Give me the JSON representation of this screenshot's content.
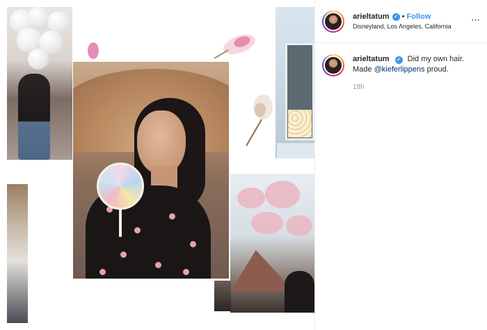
{
  "post": {
    "username": "arieltatum",
    "verified_icon": "verified-badge-icon",
    "separator": "•",
    "follow_label": "Follow",
    "location": "Disneyland, Los Angeles, California",
    "more_icon": "more-options-icon"
  },
  "caption": {
    "username": "arieltatum",
    "text_before": "Did my own hair. Made",
    "mention": "@kieferlippens",
    "text_after": "proud.",
    "time": "18h"
  },
  "colors": {
    "link_blue": "#3897f0",
    "mention_blue": "#003569",
    "muted_gray": "#999999"
  }
}
